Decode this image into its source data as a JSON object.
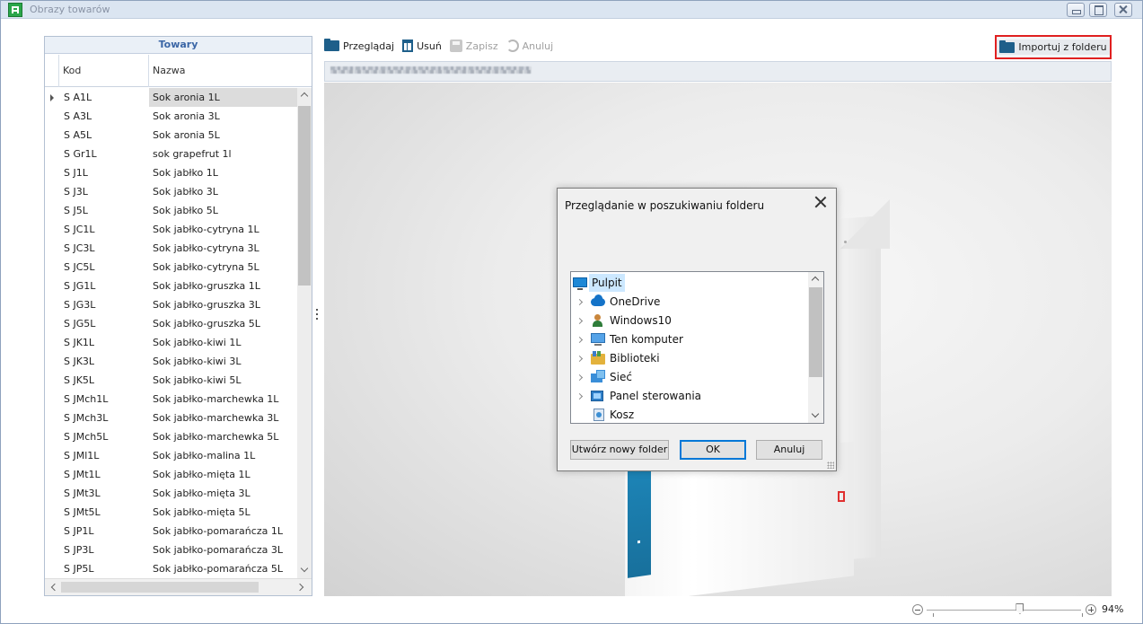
{
  "window": {
    "title": "Obrazy towarów",
    "app_icon": "app-grid-icon",
    "controls": [
      "minimize",
      "maximize",
      "close"
    ]
  },
  "grid": {
    "caption": "Towary",
    "columns": {
      "kod": "Kod",
      "nazwa": "Nazwa"
    },
    "rows": [
      {
        "kod": "S A1L",
        "nazwa": "Sok aronia 1L"
      },
      {
        "kod": "S A3L",
        "nazwa": "Sok aronia 3L"
      },
      {
        "kod": "S A5L",
        "nazwa": "Sok aronia 5L"
      },
      {
        "kod": "S Gr1L",
        "nazwa": "sok grapefrut 1l"
      },
      {
        "kod": "S J1L",
        "nazwa": "Sok jabłko 1L"
      },
      {
        "kod": "S J3L",
        "nazwa": "Sok jabłko 3L"
      },
      {
        "kod": "S J5L",
        "nazwa": "Sok jabłko 5L"
      },
      {
        "kod": "S JC1L",
        "nazwa": "Sok jabłko-cytryna 1L"
      },
      {
        "kod": "S JC3L",
        "nazwa": "Sok jabłko-cytryna 3L"
      },
      {
        "kod": "S JC5L",
        "nazwa": "Sok jabłko-cytryna 5L"
      },
      {
        "kod": "S JG1L",
        "nazwa": "Sok jabłko-gruszka 1L"
      },
      {
        "kod": "S JG3L",
        "nazwa": "Sok jabłko-gruszka 3L"
      },
      {
        "kod": "S JG5L",
        "nazwa": "Sok jabłko-gruszka 5L"
      },
      {
        "kod": "S JK1L",
        "nazwa": "Sok jabłko-kiwi 1L"
      },
      {
        "kod": "S JK3L",
        "nazwa": "Sok jabłko-kiwi 3L"
      },
      {
        "kod": "S JK5L",
        "nazwa": "Sok jabłko-kiwi 5L"
      },
      {
        "kod": "S JMch1L",
        "nazwa": "Sok jabłko-marchewka 1L"
      },
      {
        "kod": "S JMch3L",
        "nazwa": "Sok jabłko-marchewka 3L"
      },
      {
        "kod": "S JMch5L",
        "nazwa": "Sok jabłko-marchewka 5L"
      },
      {
        "kod": "S JMl1L",
        "nazwa": "Sok jabłko-malina 1L"
      },
      {
        "kod": "S JMt1L",
        "nazwa": "Sok jabłko-mięta 1L"
      },
      {
        "kod": "S JMt3L",
        "nazwa": "Sok jabłko-mięta 3L"
      },
      {
        "kod": "S JMt5L",
        "nazwa": "Sok jabłko-mięta 5L"
      },
      {
        "kod": "S JP1L",
        "nazwa": "Sok jabłko-pomarańcza 1L"
      },
      {
        "kod": "S JP3L",
        "nazwa": "Sok jabłko-pomarańcza 3L"
      },
      {
        "kod": "S JP5L",
        "nazwa": "Sok jabłko-pomarańcza 5L"
      }
    ]
  },
  "toolbar": {
    "browse": "Przeglądaj",
    "delete": "Usuń",
    "save": "Zapisz",
    "cancel": "Anuluj",
    "import_folder": "Importuj z folderu"
  },
  "dialog": {
    "title": "Przeglądanie w poszukiwaniu folderu",
    "tree": [
      {
        "label": "Pulpit",
        "icon": "desktop-icon",
        "expandable": false,
        "selected": true
      },
      {
        "label": "OneDrive",
        "icon": "cloud-icon",
        "expandable": true
      },
      {
        "label": "Windows10",
        "icon": "user-icon",
        "expandable": true
      },
      {
        "label": "Ten komputer",
        "icon": "computer-icon",
        "expandable": true
      },
      {
        "label": "Biblioteki",
        "icon": "libraries-icon",
        "expandable": true
      },
      {
        "label": "Sieć",
        "icon": "network-icon",
        "expandable": true
      },
      {
        "label": "Panel sterowania",
        "icon": "control-panel-icon",
        "expandable": true
      },
      {
        "label": "Kosz",
        "icon": "recycle-bin-icon",
        "expandable": false
      }
    ],
    "buttons": {
      "new_folder": "Utwórz nowy folder",
      "ok": "OK",
      "cancel": "Anuluj"
    }
  },
  "zoom": {
    "level_label": "94%",
    "level": 0.94
  },
  "colors": {
    "accent": "#1e5f8a",
    "highlight_border": "#e02020",
    "selection": "#cce8ff",
    "header_text": "#3b66a6"
  }
}
